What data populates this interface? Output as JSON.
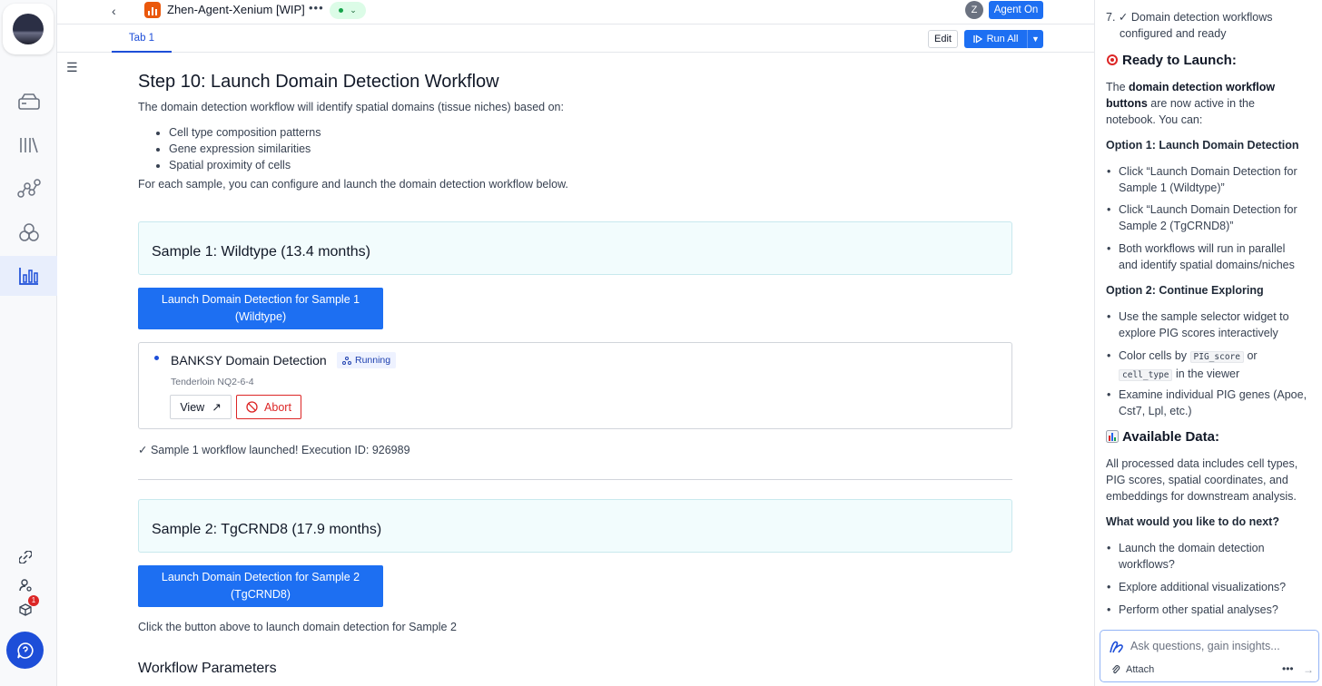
{
  "app": {
    "notebook_title": "Zhen-Agent-Xenium [WIP]",
    "more_menu": "•••",
    "avatar_initial": "Z",
    "agent_button": "Agent On",
    "accent_color": "#1d6ff2"
  },
  "tabs": [
    {
      "label": "Tab 1",
      "active": true
    }
  ],
  "toolbar": {
    "edit_label": "Edit",
    "run_all_label": "Run All"
  },
  "rail": {
    "icons": [
      "storage-icon",
      "library-icon",
      "workflow-icon",
      "cells-icon",
      "chart-icon"
    ],
    "active": "chart-icon",
    "notification_count": "1"
  },
  "notebook": {
    "heading": "Step 10: Launch Domain Detection Workflow",
    "intro": "The domain detection workflow will identify spatial domains (tissue niches) based on:",
    "bullets": [
      "Cell type composition patterns",
      "Gene expression similarities",
      "Spatial proximity of cells"
    ],
    "instruction": "For each sample, you can configure and launch the domain detection workflow below.",
    "sample1": {
      "title": "Sample 1: Wildtype (13.4 months)",
      "launch_line1": "Launch Domain Detection for Sample 1",
      "launch_line2": "(Wildtype)",
      "job": {
        "title": "BANKSY Domain Detection",
        "status": "Running",
        "subtitle": "Tenderloin NQ2-6-4",
        "view_label": "View",
        "abort_label": "Abort"
      },
      "result": "✓ Sample 1 workflow launched! Execution ID: 926989"
    },
    "sample2": {
      "title": "Sample 2: TgCRND8 (17.9 months)",
      "launch_line1": "Launch Domain Detection for Sample 2",
      "launch_line2": "(TgCRND8)",
      "hint": "Click the button above to launch domain detection for Sample 2"
    },
    "params_heading": "Workflow Parameters"
  },
  "chat": {
    "item7_line1": "7. ✓ Domain detection workflows",
    "item7_line2": "configured and ready",
    "ready_heading": "Ready to Launch:",
    "ready_p1_pre": "The ",
    "ready_p1_bold1": "domain detection workflow",
    "ready_p1_bold2": "buttons",
    "ready_p1_post1": " are now active in the",
    "ready_p1_post2": "notebook. You can:",
    "opt1_heading": "Option 1: Launch Domain Detection",
    "opt1_items": [
      [
        "Click “Launch Domain Detection for",
        "Sample 1 (Wildtype)”"
      ],
      [
        "Click “Launch Domain Detection for",
        "Sample 2 (TgCRND8)”"
      ],
      [
        "Both workflows will run in parallel",
        "and identify spatial domains/niches"
      ]
    ],
    "opt2_heading": "Option 2: Continue Exploring",
    "opt2_item1": [
      "Use the sample selector widget to",
      "explore PIG scores interactively"
    ],
    "opt2_item2_pre": "Color cells by ",
    "opt2_item2_code1": "PIG_score",
    "opt2_item2_mid": " or",
    "opt2_item2_code2": "cell_type",
    "opt2_item2_post": " in the viewer",
    "opt2_item3": [
      "Examine individual PIG genes (Apoe,",
      "Cst7, Lpl, etc.)"
    ],
    "data_heading": "Available Data:",
    "data_p": [
      "All processed data includes cell types,",
      "PIG scores, spatial coordinates, and",
      "embeddings for downstream analysis."
    ],
    "next_heading": "What would you like to do next?",
    "next_items": [
      [
        "Launch the domain detection",
        "workflows?"
      ],
      [
        "Explore additional visualizations?"
      ],
      [
        "Perform other spatial analyses?"
      ]
    ],
    "input_placeholder": "Ask questions, gain insights...",
    "attach_label": "Attach"
  }
}
